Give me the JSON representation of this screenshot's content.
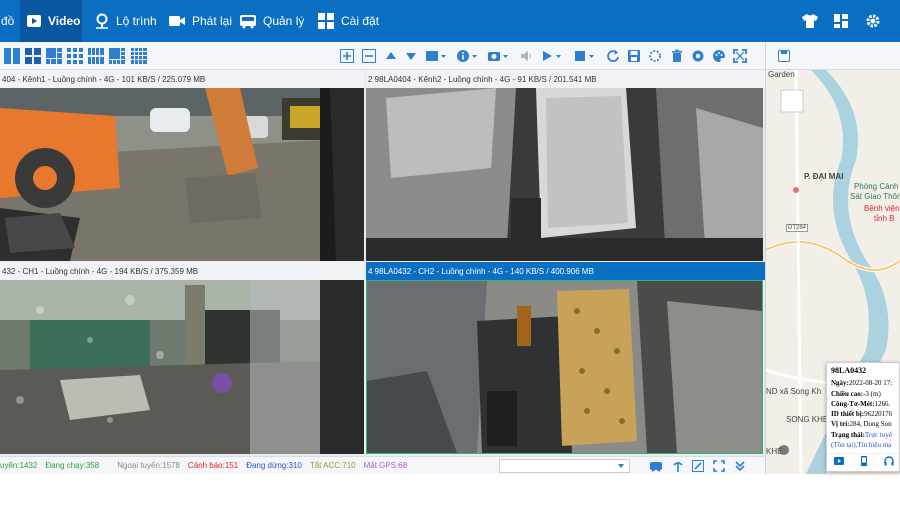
{
  "nav": {
    "items": [
      {
        "label": "đồ"
      },
      {
        "label": "Video"
      },
      {
        "label": "Lộ trình"
      },
      {
        "label": "Phát lại"
      },
      {
        "label": "Quản lý"
      },
      {
        "label": "Cài đặt"
      }
    ],
    "colors": {
      "bar": "#0a6fc2",
      "active": "#0857a0"
    }
  },
  "panes": [
    {
      "title": "404 - Kênh1 - Luồng chính - 4G - 101 KB/S / 225.079 MB"
    },
    {
      "title": "2  98LA0404 - Kênh2 - Luồng chính - 4G - 91 KB/S / 201.541 MB"
    },
    {
      "title": "432 - CH1 - Luồng chính - 4G - 194 KB/S / 375.359 MB"
    },
    {
      "title": "4  98LA0432 - CH2 - Luồng chính - 4G - 140 KB/S / 400.906 MB"
    }
  ],
  "status": {
    "items": [
      {
        "label": "uyến:1432",
        "color": "#2e9e3a"
      },
      {
        "label": "Đang chạy:358",
        "color": "#2e9e3a"
      },
      {
        "label": "Ngoại tuyến:1578",
        "color": "#888888"
      },
      {
        "label": "Cảnh báo:151",
        "color": "#d9262c"
      },
      {
        "label": "Đang dừng:310",
        "color": "#2a4fd6"
      },
      {
        "label": "Tắt ACC:710",
        "color": "#9a9a2a"
      },
      {
        "label": "Mất GPS:68",
        "color": "#b05cd6"
      }
    ]
  },
  "map": {
    "labels": {
      "garden": "Garden",
      "dai_mai": "P. ĐẠI MAI",
      "police_1": "Phòng Cảnh",
      "police_2": "Sát Giao Thông",
      "hospital_1": "Bệnh viện",
      "hospital_2": "tỉnh B",
      "road": "DT284",
      "ward": "ND xã Song Kh",
      "songkhe": "SONG KHE",
      "khe": "KHÊ"
    }
  },
  "popup": {
    "plate": "98LA0432",
    "rows": [
      {
        "k": "Ngày:",
        "v": "2022-08-20 17:",
        "color": "#333"
      },
      {
        "k": "Chiều cao:",
        "v": "-3 (m)",
        "color": "#333"
      },
      {
        "k": "Công-Tơ-Mét:",
        "v": "1266.",
        "color": "#333"
      },
      {
        "k": "ID thiết bị:",
        "v": "96220176",
        "color": "#333"
      },
      {
        "k": "Vị trí:",
        "v": "284, Dong Son",
        "color": "#333"
      },
      {
        "k": "Trạng thái:",
        "v": "Trực tuyế",
        "color": "#2a4fd6"
      }
    ],
    "extra": "(Tồn tại),Tín hiệu mạ"
  }
}
